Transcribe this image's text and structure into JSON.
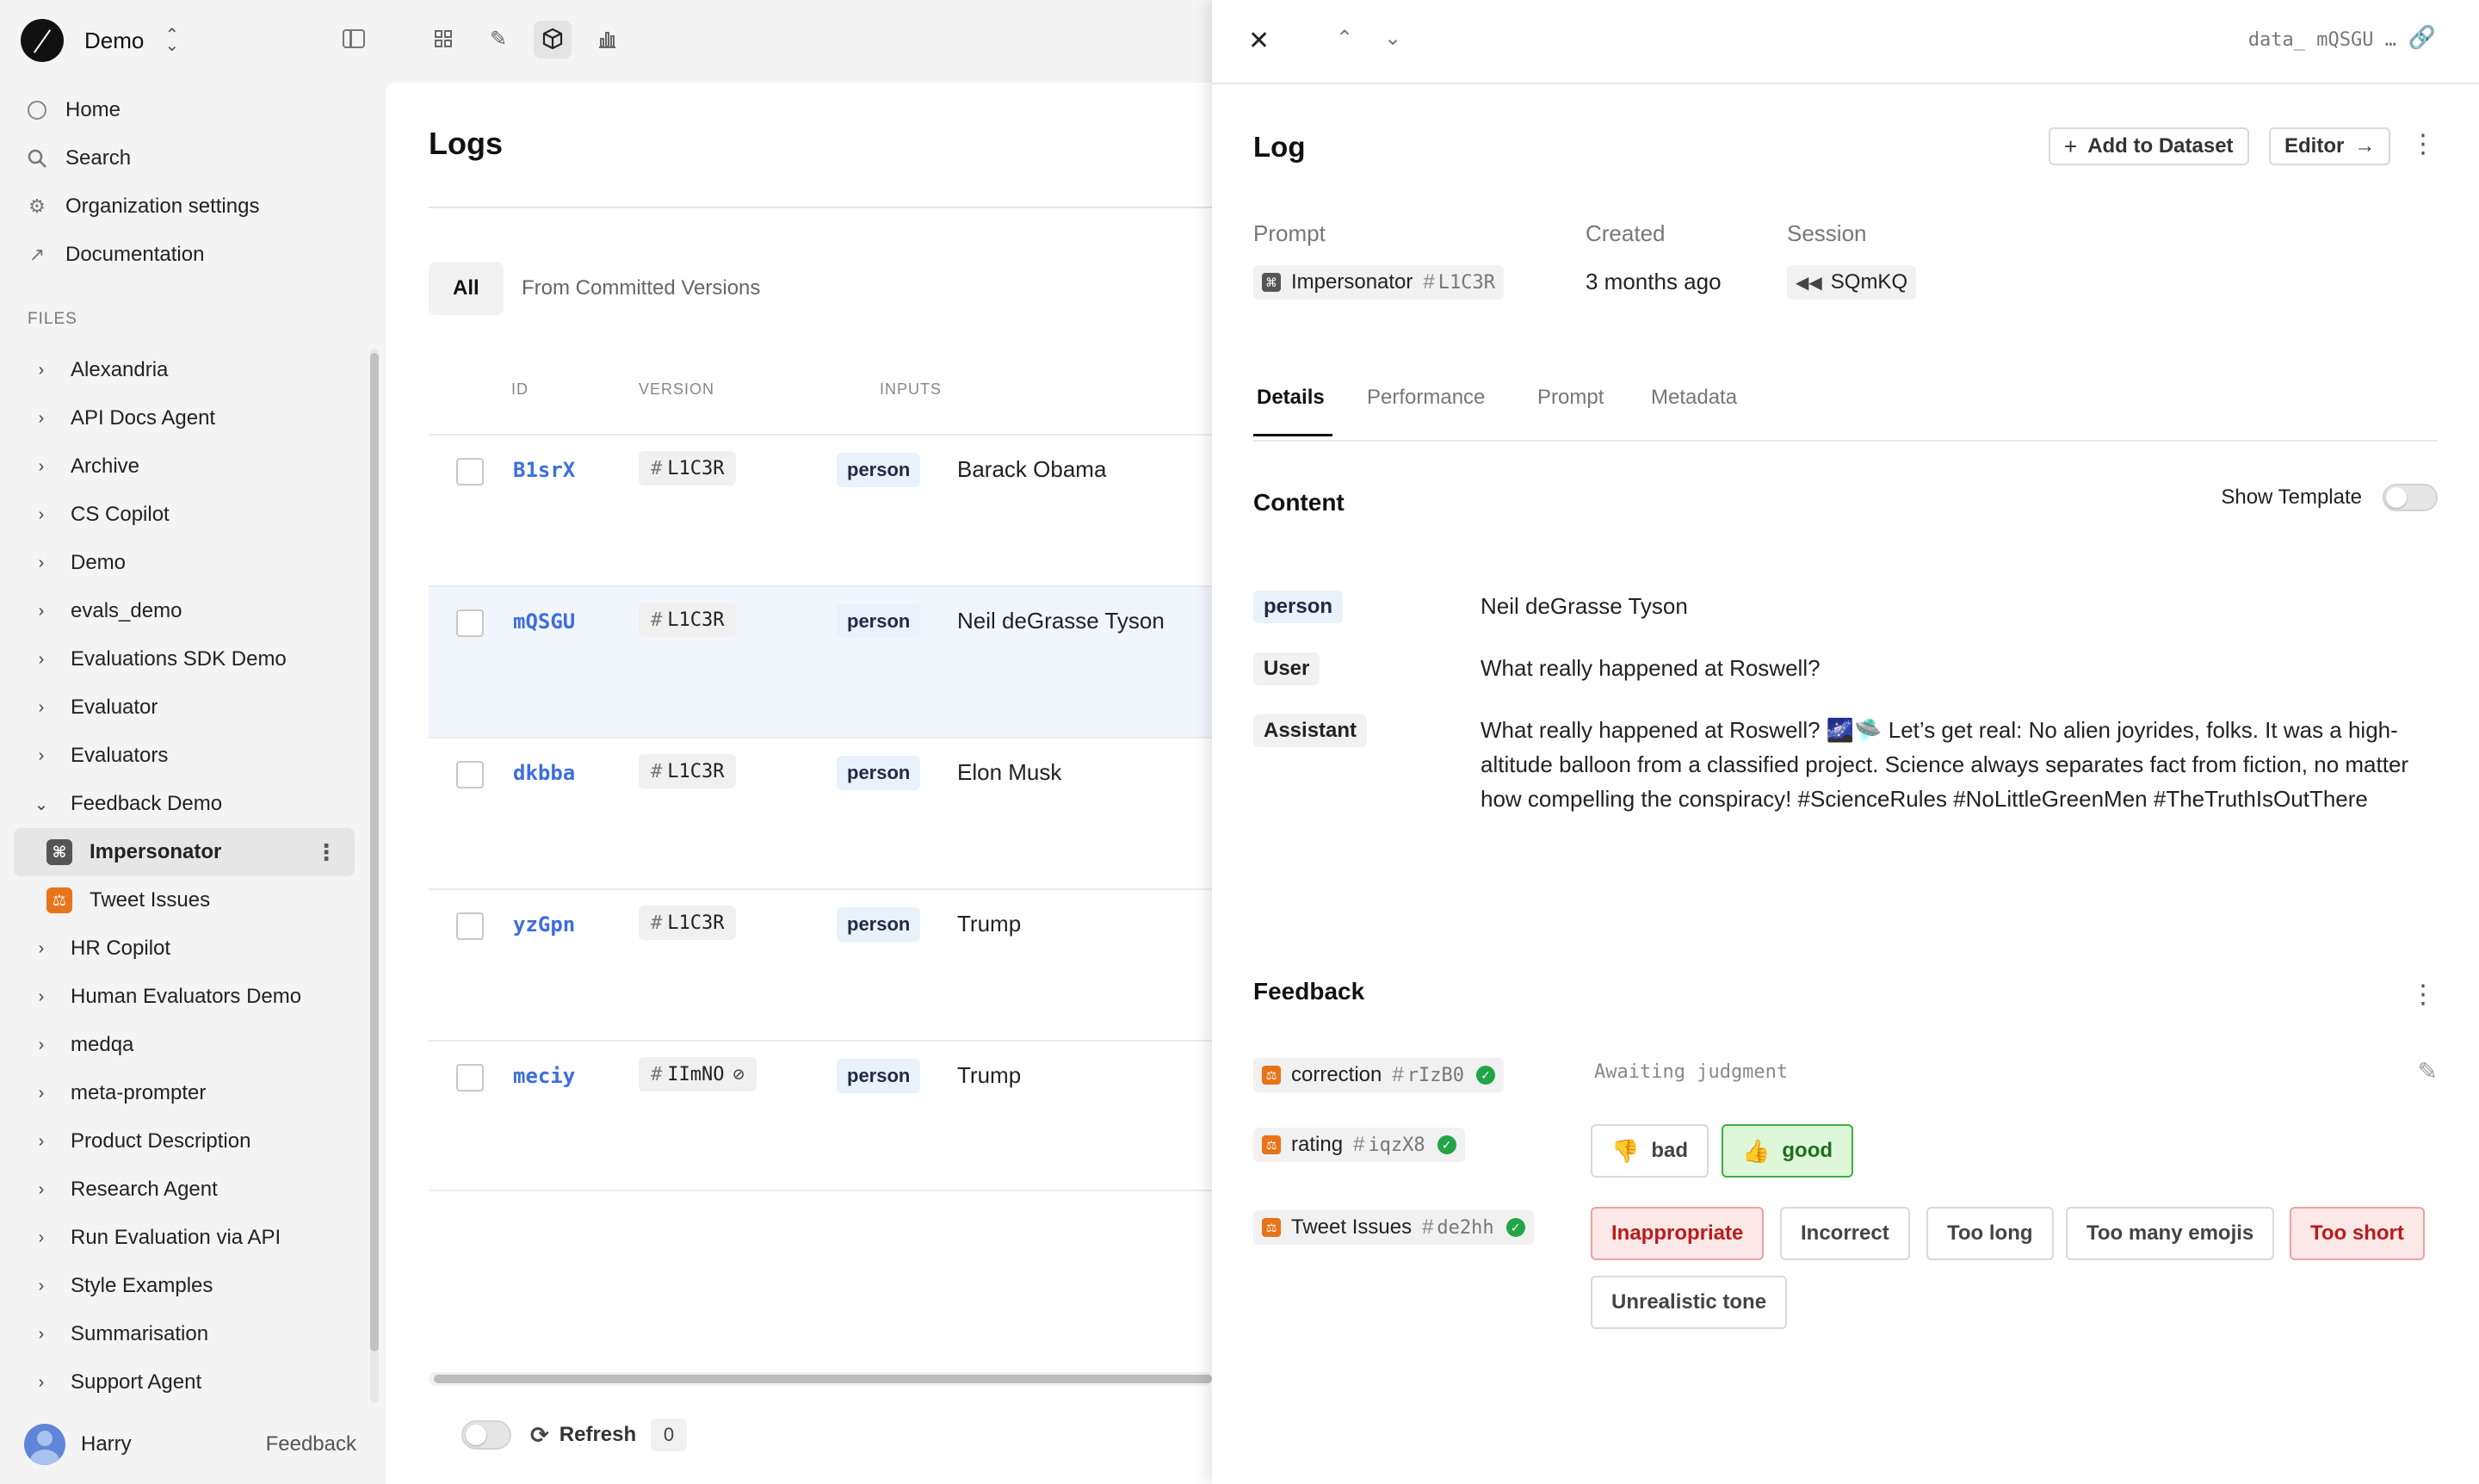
{
  "workspace": {
    "name": "Demo"
  },
  "nav": [
    {
      "label": "Home",
      "icon": "home-icon"
    },
    {
      "label": "Search",
      "icon": "search-icon"
    },
    {
      "label": "Organization settings",
      "icon": "gear-icon"
    },
    {
      "label": "Documentation",
      "icon": "external-link-icon"
    }
  ],
  "files_label": "FILES",
  "files": [
    {
      "label": "Alexandria"
    },
    {
      "label": "API Docs Agent"
    },
    {
      "label": "Archive"
    },
    {
      "label": "CS Copilot"
    },
    {
      "label": "Demo"
    },
    {
      "label": "evals_demo"
    },
    {
      "label": "Evaluations SDK Demo"
    },
    {
      "label": "Evaluator"
    },
    {
      "label": "Evaluators"
    },
    {
      "label": "Feedback Demo"
    },
    {
      "label": "Impersonator"
    },
    {
      "label": "Tweet Issues"
    },
    {
      "label": "HR Copilot"
    },
    {
      "label": "Human Evaluators Demo"
    },
    {
      "label": "medqa"
    },
    {
      "label": "meta-prompter"
    },
    {
      "label": "Product Description"
    },
    {
      "label": "Research Agent"
    },
    {
      "label": "Run Evaluation via API"
    },
    {
      "label": "Style Examples"
    },
    {
      "label": "Summarisation"
    },
    {
      "label": "Support Agent"
    }
  ],
  "user": {
    "name": "Harry",
    "feedback_label": "Feedback"
  },
  "main": {
    "title": "Logs",
    "tabs": [
      {
        "label": "All"
      },
      {
        "label": "From Committed Versions"
      }
    ],
    "columns": {
      "id": "ID",
      "version": "VERSION",
      "inputs": "INPUTS"
    },
    "rows": [
      {
        "id": "B1srX",
        "version": "L1C3R",
        "input_key": "person",
        "input_value": "Barack Obama"
      },
      {
        "id": "mQSGU",
        "version": "L1C3R",
        "input_key": "person",
        "input_value": "Neil deGrasse Tyson"
      },
      {
        "id": "dkbba",
        "version": "L1C3R",
        "input_key": "person",
        "input_value": "Elon Musk"
      },
      {
        "id": "yzGpn",
        "version": "L1C3R",
        "input_key": "person",
        "input_value": "Trump"
      },
      {
        "id": "meciy",
        "version": "IImNO",
        "input_key": "person",
        "input_value": "Trump"
      }
    ],
    "footer": {
      "refresh_label": "Refresh",
      "refresh_count": "0"
    }
  },
  "drawer": {
    "path": "data_ mQSGU …",
    "title": "Log",
    "add_to_dataset": "Add to Dataset",
    "editor": "Editor",
    "meta": {
      "prompt_label": "Prompt",
      "prompt_name": "Impersonator",
      "prompt_version": "L1C3R",
      "created_label": "Created",
      "created_value": "3 months ago",
      "session_label": "Session",
      "session_value": "SQmKQ"
    },
    "tabs": [
      {
        "label": "Details"
      },
      {
        "label": "Performance"
      },
      {
        "label": "Prompt"
      },
      {
        "label": "Metadata"
      }
    ],
    "content": {
      "title": "Content",
      "show_template": "Show Template",
      "messages": [
        {
          "role": "person",
          "text": "Neil deGrasse Tyson"
        },
        {
          "role": "User",
          "text": "What really happened at Roswell?"
        },
        {
          "role": "Assistant",
          "text": "What really happened at Roswell? 🌌🛸 Let’s get real: No alien joyrides, folks. It was a high-altitude balloon from a classified project. Science always separates fact from fiction, no matter how compelling the conspiracy! #ScienceRules #NoLittleGreenMen #TheTruthIsOutThere"
        }
      ]
    },
    "feedback": {
      "title": "Feedback",
      "items": [
        {
          "name": "correction",
          "version": "rIzB0"
        },
        {
          "name": "rating",
          "version": "iqzX8"
        },
        {
          "name": "Tweet Issues",
          "version": "de2hh"
        }
      ],
      "awaiting": "Awaiting judgment",
      "rating_options": [
        {
          "label": "bad"
        },
        {
          "label": "good"
        }
      ],
      "issue_options": [
        {
          "label": "Inappropriate"
        },
        {
          "label": "Incorrect"
        },
        {
          "label": "Too long"
        },
        {
          "label": "Too many emojis"
        },
        {
          "label": "Too short"
        },
        {
          "label": "Unrealistic tone"
        }
      ]
    }
  },
  "colors": {
    "accent_blue": "#3d6ee0",
    "evaluator_orange": "#e8741a",
    "good_green": "#3cb03c",
    "danger_red": "#b91c1c"
  }
}
